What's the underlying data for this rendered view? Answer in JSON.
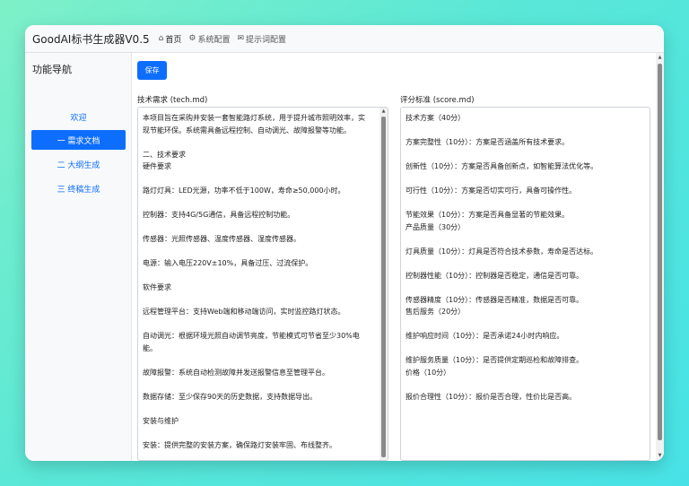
{
  "app": {
    "title": "GoodAI标书生成器V0.5"
  },
  "nav": {
    "home": {
      "icon": "home-icon",
      "label": "首页"
    },
    "system": {
      "icon": "gear-icon",
      "label": "系统配置"
    },
    "prompt": {
      "icon": "message-icon",
      "label": "提示词配置"
    }
  },
  "sidebar": {
    "title": "功能导航",
    "items": [
      {
        "label": "欢迎",
        "active": false
      },
      {
        "label": "一 需求文档",
        "active": true
      },
      {
        "label": "二 大纲生成",
        "active": false
      },
      {
        "label": "三 终稿生成",
        "active": false
      }
    ]
  },
  "main": {
    "save_label": "保存",
    "tech": {
      "label": "技术需求 (tech.md)",
      "content": "本项目旨在采购并安装一套智能路灯系统，用于提升城市照明效率，实现节能环保。系统需具备远程控制、自动调光、故障报警等功能。\n\n二、技术要求\n硬件要求\n\n路灯灯具：LED光源，功率不低于100W，寿命≥50,000小时。\n\n控制器：支持4G/5G通信，具备远程控制功能。\n\n传感器：光照传感器、温度传感器、湿度传感器。\n\n电源：输入电压220V±10%，具备过压、过流保护。\n\n软件要求\n\n远程管理平台：支持Web端和移动端访问，实时监控路灯状态。\n\n自动调光：根据环境光照自动调节亮度，节能模式可节省至少30%电能。\n\n故障报警：系统自动检测故障并发送报警信息至管理平台。\n\n数据存储：至少保存90天的历史数据，支持数据导出。\n\n安装与维护\n\n安装：提供完整的安装方案，确保路灯安装牢固、布线整齐。"
    },
    "score": {
      "label": "评分标准 (score.md)",
      "content": "技术方案（40分）\n\n方案完整性（10分）：方案是否涵盖所有技术要求。\n\n创新性（10分）：方案是否具备创新点，如智能算法优化等。\n\n可行性（10分）：方案是否切实可行，具备可操作性。\n\n节能效果（10分）：方案是否具备显著的节能效果。\n产品质量（30分）\n\n灯具质量（10分）：灯具是否符合技术参数，寿命是否达标。\n\n控制器性能（10分）：控制器是否稳定，通信是否可靠。\n\n传感器精度（10分）：传感器是否精准，数据是否可靠。\n售后服务（20分）\n\n维护响应时间（10分）：是否承诺24小时内响应。\n\n维护服务质量（10分）：是否提供定期巡检和故障排查。\n价格（10分）\n\n报价合理性（10分）：报价是否合理，性价比是否高。"
    }
  },
  "colors": {
    "accent": "#0d6efd",
    "background_from": "#7ef0c8",
    "background_to": "#48e2e6"
  }
}
